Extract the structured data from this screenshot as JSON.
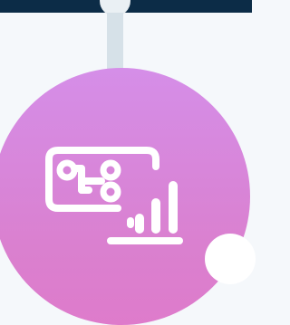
{
  "colors": {
    "top_bar": "#0c2c47",
    "background": "#f5f8fb",
    "connector": "#d6e1e8",
    "badge_top": "#d58ee8",
    "badge_bottom": "#de7bcb",
    "icon": "#ffffff"
  },
  "badge": {
    "icon": "process-flow-analytics-icon"
  }
}
